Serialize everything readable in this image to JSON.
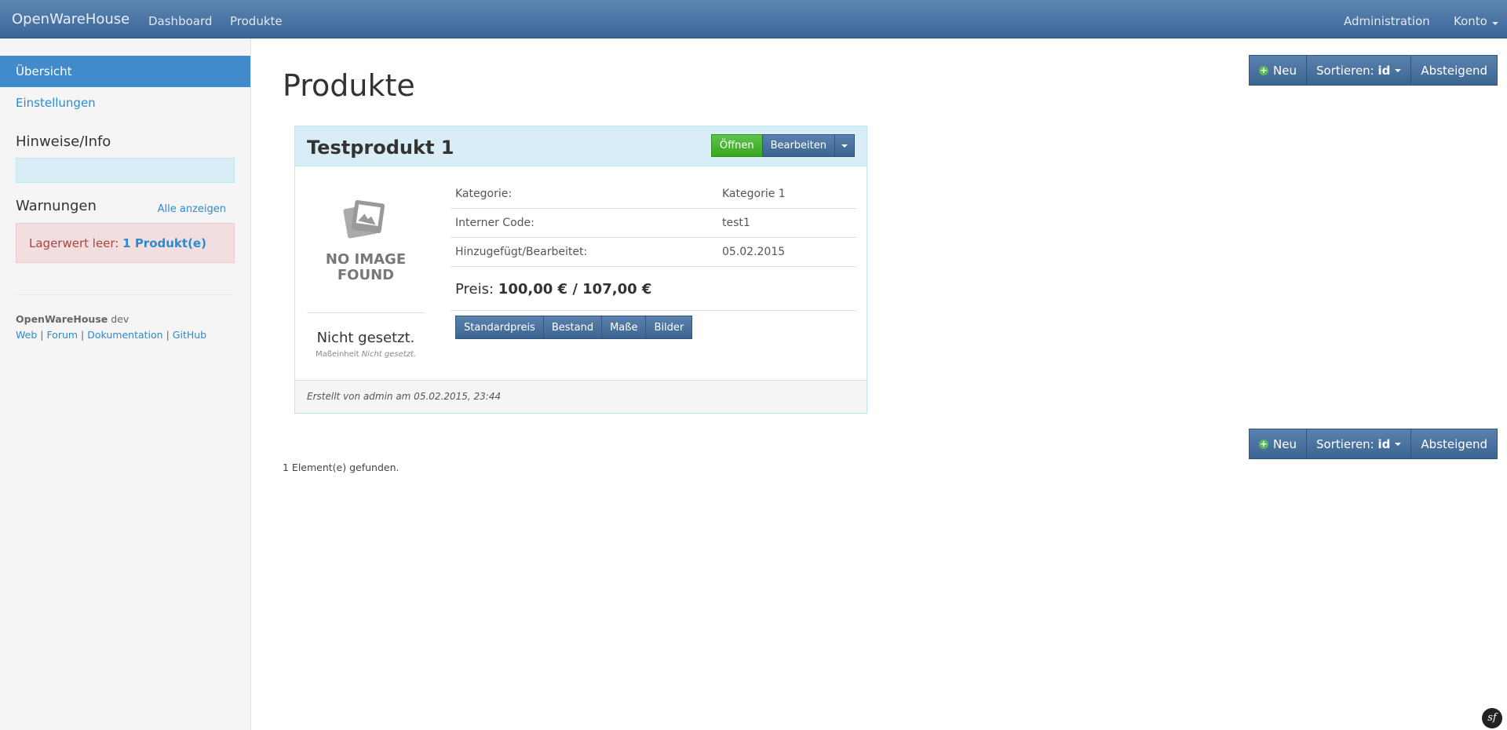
{
  "navbar": {
    "brand": "OpenWareHouse",
    "links": [
      "Dashboard",
      "Produkte"
    ],
    "right": [
      "Administration",
      "Konto"
    ]
  },
  "sidebar": {
    "items": [
      {
        "label": "Übersicht",
        "active": true
      },
      {
        "label": "Einstellungen",
        "active": false
      }
    ],
    "info_heading": "Hinweise/Info",
    "warnings_heading": "Warnungen",
    "warnings_all": "Alle anzeigen",
    "warning_text": "Lagerwert leer:",
    "warning_link": "1 Produkt(e)",
    "footer": {
      "app_name": "OpenWareHouse",
      "version": "dev",
      "links": [
        "Web",
        "Forum",
        "Dokumentation",
        "GitHub"
      ]
    }
  },
  "main": {
    "title": "Produkte",
    "toolbar": {
      "new_label": "Neu",
      "sort_label": "Sortieren:",
      "sort_value": "id",
      "order_label": "Absteigend"
    },
    "product": {
      "name": "Testprodukt 1",
      "open_label": "Öffnen",
      "edit_label": "Bearbeiten",
      "no_image": [
        "NO IMAGE",
        "FOUND"
      ],
      "unit_main": "Nicht gesetzt.",
      "unit_label": "Maßeinheit",
      "unit_value": "Nicht gesetzt.",
      "properties": [
        {
          "key": "Kategorie:",
          "value": "Kategorie 1"
        },
        {
          "key": "Interner Code:",
          "value": "test1"
        },
        {
          "key": "Hinzugefügt/Bearbeitet:",
          "value": "05.02.2015"
        }
      ],
      "price_label": "Preis:",
      "price_value": "100,00 € / 107,00 €",
      "tabs": [
        "Standardpreis",
        "Bestand",
        "Maße",
        "Bilder"
      ],
      "footer": "Erstellt von admin am 05.02.2015, 23:44"
    },
    "found_text": "1 Element(e) gefunden."
  },
  "colors": {
    "navbar": "#4a74a4",
    "active": "#428bca",
    "success": "#3aa922",
    "danger": "#a94442"
  }
}
